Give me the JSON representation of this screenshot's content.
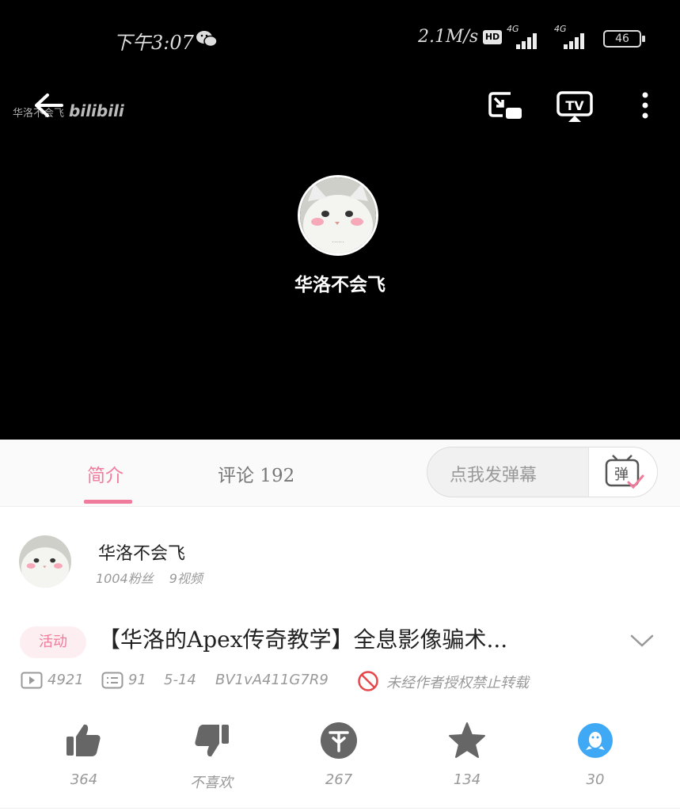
{
  "status_bar": {
    "time": "下午3:07",
    "speed": "2.1M/s",
    "hd": "HD",
    "net1": "4G",
    "net2": "4G",
    "battery": "46"
  },
  "player": {
    "watermark_name": "华洛不会飞",
    "watermark_brand": "bilibili",
    "uploader_name": "华洛不会飞"
  },
  "tabs": {
    "intro": "简介",
    "comments": "评论 192"
  },
  "danmu": {
    "placeholder": "点我发弹幕",
    "button": "弹"
  },
  "author": {
    "name": "华洛不会飞",
    "fans": "1004粉丝",
    "videos": "9视频"
  },
  "video": {
    "tag": "活动",
    "title": "【华洛的Apex传奇教学】全息影像骗术...",
    "plays": "4921",
    "danmaku": "91",
    "date": "5-14",
    "bvid": "BV1vA411G7R9",
    "copyright": "未经作者授权禁止转载"
  },
  "actions": {
    "like": "364",
    "dislike": "不喜欢",
    "coin": "267",
    "favorite": "134",
    "share": "30"
  },
  "colors": {
    "accent": "#f07c9c",
    "share_blue": "#3fa9f5",
    "icon_gray": "#666666"
  }
}
